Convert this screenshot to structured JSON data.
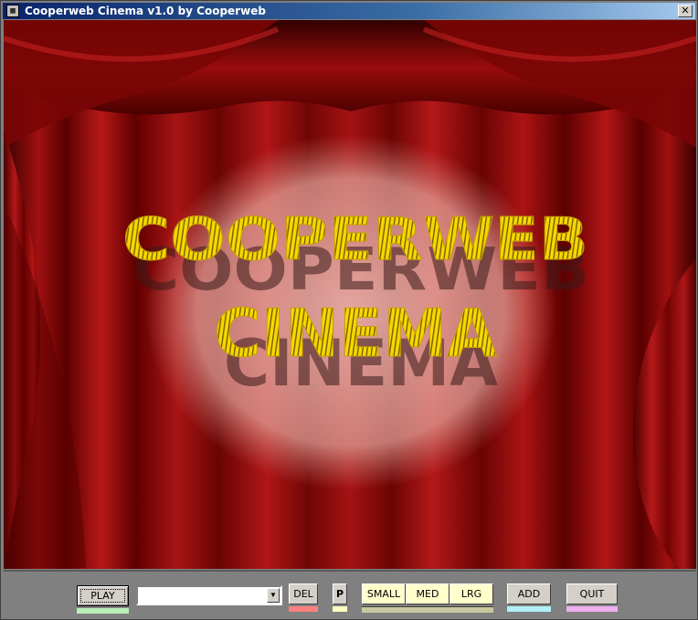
{
  "window": {
    "title": "Cooperweb Cinema  v1.0 by Cooperweb",
    "close_label": "✕",
    "icon": "app-icon"
  },
  "stage": {
    "logo_line1": "COOPERWEB",
    "logo_line2": "CINEMA",
    "colors": {
      "curtain_dark": "#4a0000",
      "curtain_mid": "#8b0a0a",
      "curtain_light": "#c82020",
      "spotlight": "#e8b0a8",
      "logo_fill": "#f5d800",
      "logo_shadow": "#3a1a18"
    }
  },
  "controls": {
    "play_label": "PLAY",
    "movie_select_value": "",
    "del_label": "DEL",
    "p_label": "P",
    "small_label": "SMALL",
    "med_label": "MED",
    "lrg_label": "LRG",
    "add_label": "ADD",
    "quit_label": "QUIT",
    "colors": {
      "play_underline": "#b8f0b8",
      "del_underline": "#ff8080",
      "p_underline": "#ffffc0",
      "size_underline": "#c8c8a0",
      "add_underline": "#b0f0f8",
      "quit_underline": "#f0b0f0"
    }
  }
}
